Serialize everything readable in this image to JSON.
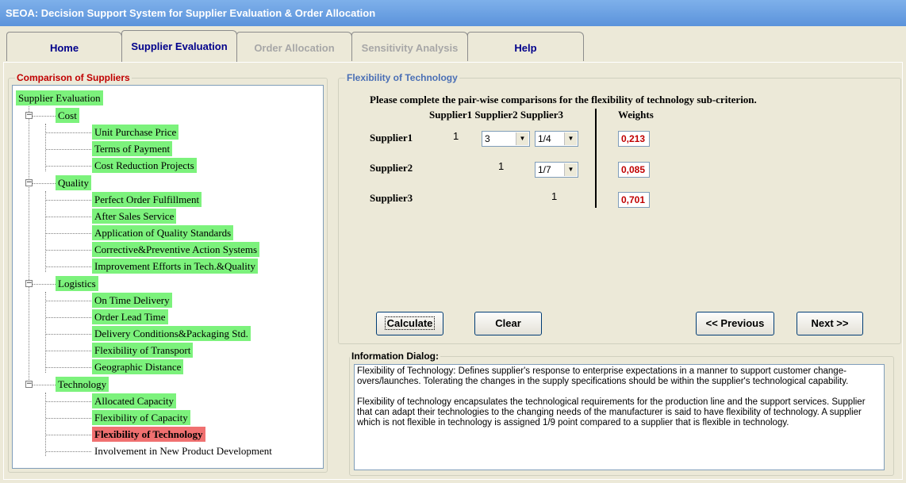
{
  "window": {
    "title": "SEOA: Decision Support System for Supplier Evaluation & Order Allocation"
  },
  "tabs": [
    {
      "label": "Home",
      "state": "enabled"
    },
    {
      "label": "Supplier Evaluation",
      "state": "active"
    },
    {
      "label": "Order Allocation",
      "state": "disabled"
    },
    {
      "label": "Sensitivity Analysis",
      "state": "disabled"
    },
    {
      "label": "Help",
      "state": "enabled"
    }
  ],
  "tree": {
    "group_label": "Comparison of Suppliers",
    "root": "Supplier Evaluation",
    "cost": {
      "label": "Cost",
      "items": [
        "Unit Purchase Price",
        "Terms of Payment",
        "Cost Reduction Projects"
      ]
    },
    "quality": {
      "label": "Quality",
      "items": [
        "Perfect Order Fulfillment",
        "After Sales Service",
        "Application of Quality Standards",
        "Corrective&Preventive Action Systems",
        "Improvement Efforts in Tech.&Quality"
      ]
    },
    "logistics": {
      "label": "Logistics",
      "items": [
        "On Time Delivery",
        "Order Lead Time",
        "Delivery Conditions&Packaging Std.",
        "Flexibility of Transport",
        "Geographic Distance"
      ]
    },
    "technology": {
      "label": "Technology",
      "items": [
        "Allocated Capacity",
        "Flexibility of Capacity",
        "Flexibility of Technology",
        "Involvement in New Product Development"
      ]
    },
    "expander_glyph": "−"
  },
  "comparison": {
    "group_label": "Flexibility of Technology",
    "instruction": "Please complete the pair-wise comparisons for the flexibility of technology sub-criterion.",
    "col_header": "Supplier1 Supplier2 Supplier3",
    "weights_header": "Weights",
    "rows": [
      {
        "label": "Supplier1",
        "diag": "1",
        "s2": "3",
        "s3": "1/4",
        "weight": "0,213"
      },
      {
        "label": "Supplier2",
        "diag": "1",
        "s3": "1/7",
        "weight": "0,085"
      },
      {
        "label": "Supplier3",
        "diag": "1",
        "weight": "0,701"
      }
    ],
    "dropdown_arrow": "▼"
  },
  "buttons": {
    "calculate": "Calculate",
    "clear": "Clear",
    "previous": "<< Previous",
    "next": "Next >>"
  },
  "info": {
    "group_label": "Information Dialog:",
    "para1": "Flexibility of Technology:  Defines supplier's response to enterprise expectations in a manner to support customer change-overs/launches. Tolerating the changes in the supply specifications should be within the supplier's technological capability.",
    "para2": "Flexibility of technology encapsulates the technological requirements for the production line and the support services. Supplier that can adapt their technologies to the changing needs of the manufacturer is said to have flexibility of technology. A supplier which is not flexible in technology is assigned 1/9 point compared to a supplier that is flexible in technology."
  },
  "colors": {
    "title_bar": "#5b93db",
    "tree_highlight": "#7cf27c",
    "tree_selected": "#f07070",
    "group_label_left": "#c00000",
    "group_label_right": "#4a6fb5",
    "weight_text": "#c00000"
  }
}
